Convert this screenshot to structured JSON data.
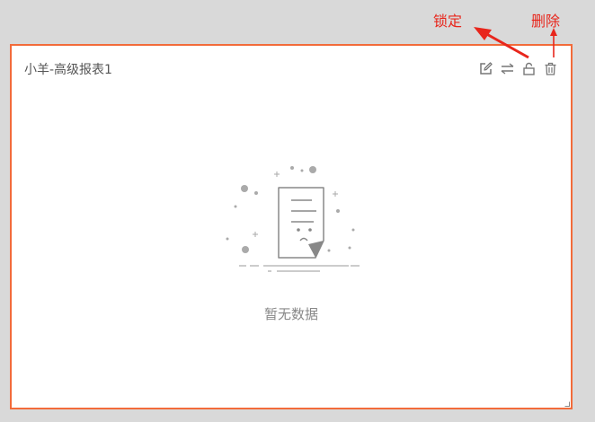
{
  "card": {
    "title": "小羊-高级报表1",
    "empty_text": "暂无数据",
    "border_color": "#f26b3a"
  },
  "toolbar": {
    "icons": [
      "edit-icon",
      "swap-icon",
      "unlock-icon",
      "trash-icon"
    ],
    "icon_color": "#777777"
  },
  "annotations": {
    "lock_label": "锁定",
    "delete_label": "删除",
    "color": "#e8261c"
  }
}
